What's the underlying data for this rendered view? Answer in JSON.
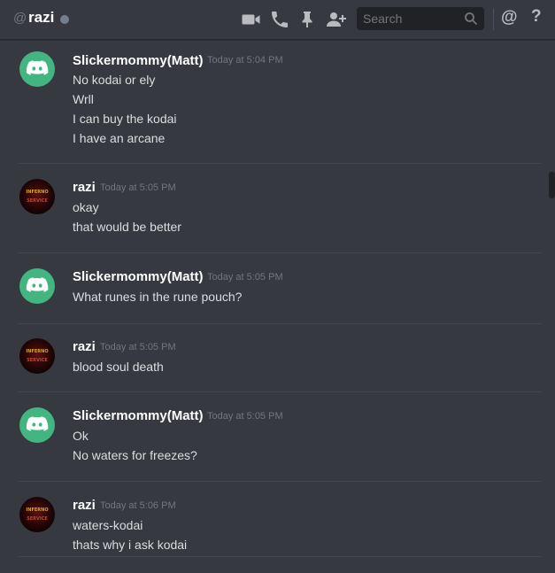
{
  "header": {
    "at_symbol": "@",
    "channel_name": "razi",
    "search_placeholder": "Search",
    "mention_symbol": "@",
    "help_symbol": "?"
  },
  "messages": [
    {
      "author": "Slickermommy(Matt)",
      "avatar": "discord-logo",
      "timestamp": "Today at 5:04 PM",
      "lines": [
        "No kodai or ely",
        "Wrll",
        "I can buy the kodai",
        "I have an arcane"
      ]
    },
    {
      "author": "razi",
      "avatar": "infernal-serpent",
      "avatar_text": [
        "INFERNO",
        "SERVICE"
      ],
      "timestamp": "Today at 5:05 PM",
      "lines": [
        "okay",
        "that would be better"
      ]
    },
    {
      "author": "Slickermommy(Matt)",
      "avatar": "discord-logo",
      "timestamp": "Today at 5:05 PM",
      "lines": [
        "What runes in the rune pouch?"
      ]
    },
    {
      "author": "razi",
      "avatar": "infernal-serpent",
      "avatar_text": [
        "INFERNO",
        "SERVICE"
      ],
      "timestamp": "Today at 5:05 PM",
      "lines": [
        "blood soul death"
      ]
    },
    {
      "author": "Slickermommy(Matt)",
      "avatar": "discord-logo",
      "timestamp": "Today at 5:05 PM",
      "lines": [
        "Ok",
        "No waters for freezes?"
      ]
    },
    {
      "author": "razi",
      "avatar": "infernal-serpent",
      "avatar_text": [
        "INFERNO",
        "SERVICE"
      ],
      "timestamp": "Today at 5:06 PM",
      "lines": [
        "waters-kodai",
        "thats why i ask kodai"
      ]
    }
  ],
  "colors": {
    "background": "#36393f",
    "discord_green": "#43b581",
    "username": "#ffffff",
    "message_text": "#dcddde",
    "timestamp": "#72767d"
  }
}
